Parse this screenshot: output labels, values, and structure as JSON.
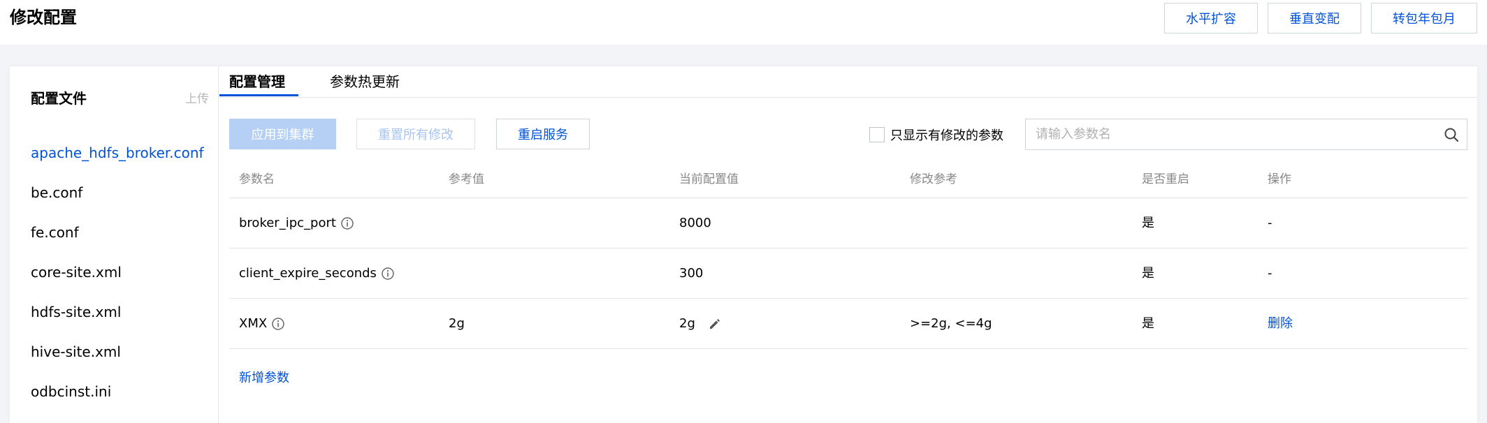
{
  "header": {
    "title": "修改配置",
    "buttons": [
      "水平扩容",
      "垂直变配",
      "转包年包月"
    ]
  },
  "sidebar": {
    "title": "配置文件",
    "upload": "上传",
    "items": [
      {
        "label": "apache_hdfs_broker.conf",
        "active": true
      },
      {
        "label": "be.conf"
      },
      {
        "label": "fe.conf"
      },
      {
        "label": "core-site.xml"
      },
      {
        "label": "hdfs-site.xml"
      },
      {
        "label": "hive-site.xml"
      },
      {
        "label": "odbcinst.ini"
      }
    ]
  },
  "tabs": [
    {
      "label": "配置管理",
      "active": true
    },
    {
      "label": "参数热更新"
    }
  ],
  "toolbar": {
    "apply_label": "应用到集群",
    "reset_label": "重置所有修改",
    "restart_label": "重启服务",
    "only_modified_label": "只显示有修改的参数",
    "search_placeholder": "请输入参数名"
  },
  "table": {
    "columns": [
      "参数名",
      "参考值",
      "当前配置值",
      "修改参考",
      "是否重启",
      "操作"
    ],
    "rows": [
      {
        "name": "broker_ipc_port",
        "ref": "",
        "current": "8000",
        "hint": "",
        "restart": "是",
        "action": "-"
      },
      {
        "name": "client_expire_seconds",
        "ref": "",
        "current": "300",
        "hint": "",
        "restart": "是",
        "action": "-"
      },
      {
        "name": "XMX",
        "ref": "2g",
        "current": "2g",
        "hint": ">=2g, <=4g",
        "restart": "是",
        "action": "删除"
      }
    ]
  },
  "add_param_label": "新增参数",
  "colors": {
    "accent": "#0052d9",
    "disabled_primary": "#b5cff5"
  },
  "icons": {
    "info": "info-icon",
    "edit": "pencil-icon",
    "search": "search-icon"
  }
}
